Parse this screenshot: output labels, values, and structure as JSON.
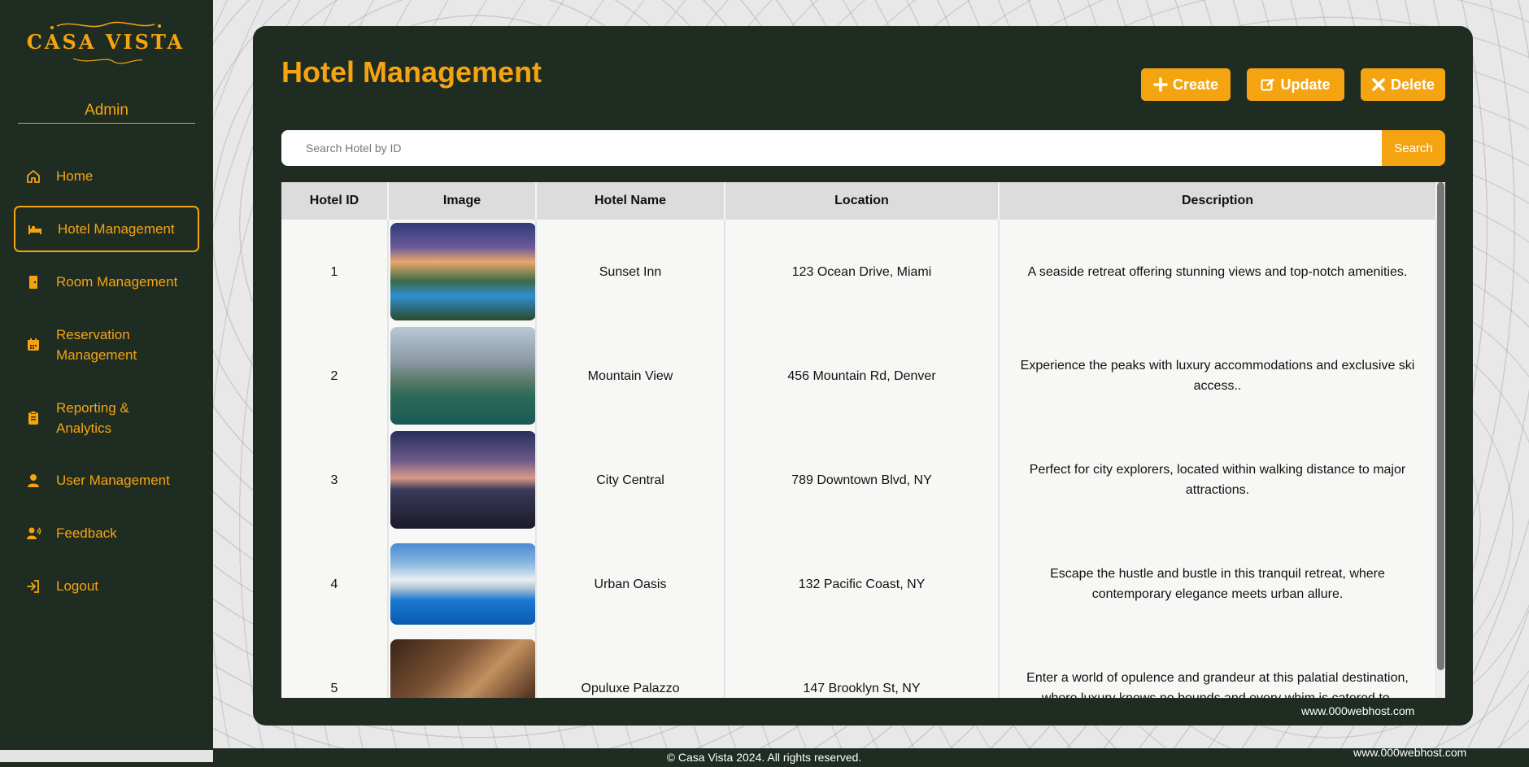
{
  "brand": {
    "name": "CASA VISTA"
  },
  "sidebar": {
    "role_label": "Admin",
    "items": [
      {
        "label": "Home",
        "icon": "home-icon"
      },
      {
        "label": "Hotel Management",
        "icon": "bed-icon",
        "active": true
      },
      {
        "label": "Room Management",
        "icon": "door-icon"
      },
      {
        "label": "Reservation Management",
        "icon": "calendar-icon"
      },
      {
        "label": "Reporting & Analytics",
        "icon": "clipboard-icon"
      },
      {
        "label": "User Management",
        "icon": "user-icon"
      },
      {
        "label": "Feedback",
        "icon": "feedback-icon"
      },
      {
        "label": "Logout",
        "icon": "logout-icon"
      }
    ]
  },
  "main": {
    "title": "Hotel Management",
    "actions": {
      "create": "Create",
      "update": "Update",
      "delete": "Delete"
    },
    "search": {
      "placeholder": "Search Hotel by ID",
      "button": "Search"
    },
    "table": {
      "columns": [
        "Hotel ID",
        "Image",
        "Hotel Name",
        "Location",
        "Description"
      ],
      "rows": [
        {
          "id": "1",
          "name": "Sunset Inn",
          "location": "123 Ocean Drive, Miami",
          "description": "A seaside retreat offering stunning views and top-notch amenities."
        },
        {
          "id": "2",
          "name": "Mountain View",
          "location": "456 Mountain Rd, Denver",
          "description": "Experience the peaks with luxury accommodations and exclusive ski access.."
        },
        {
          "id": "3",
          "name": "City Central",
          "location": "789 Downtown Blvd, NY",
          "description": "Perfect for city explorers, located within walking distance to major attractions."
        },
        {
          "id": "4",
          "name": "Urban Oasis",
          "location": "132 Pacific Coast, NY",
          "description": "Escape the hustle and bustle in this tranquil retreat, where contemporary elegance meets urban allure."
        },
        {
          "id": "5",
          "name": "Opuluxe Palazzo",
          "location": "147 Brooklyn St, NY",
          "description": "Enter a world of opulence and grandeur at this palatial destination, where luxury knows no bounds and every whim is catered to."
        }
      ]
    }
  },
  "footer": {
    "copyright": "© Casa Vista 2024. All rights reserved.",
    "host_badge": "www.000webhost.com"
  },
  "colors": {
    "accent": "#f5a411",
    "dark": "#1f2c22"
  }
}
